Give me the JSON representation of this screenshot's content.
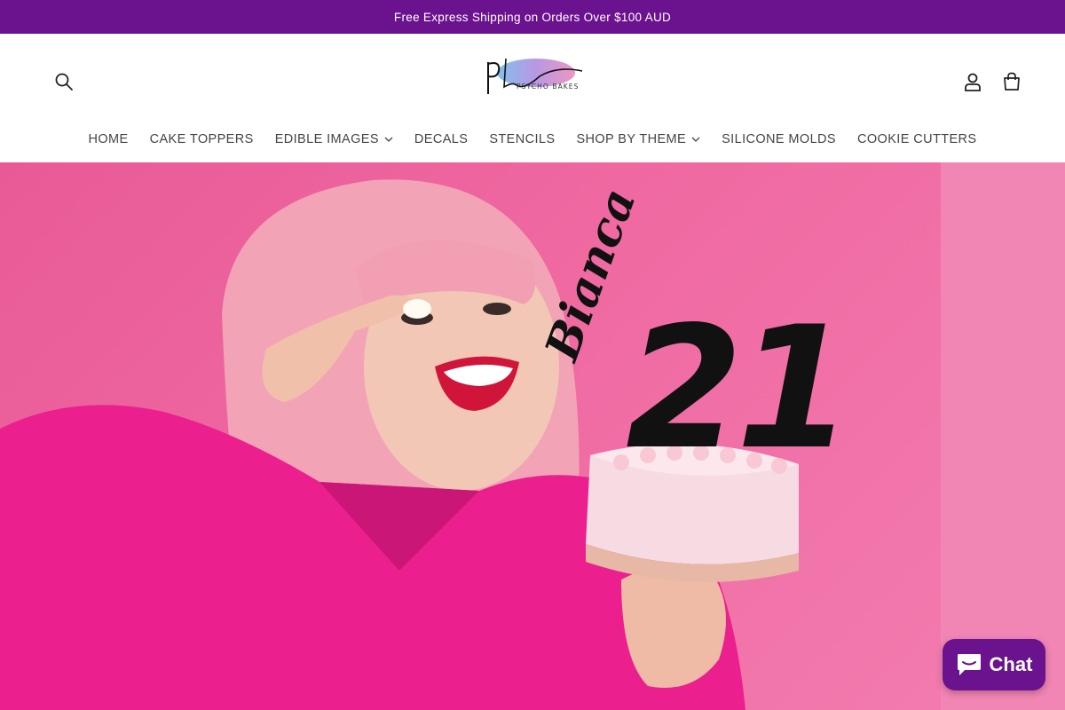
{
  "announcement": "Free Express Shipping on Orders Over $100 AUD",
  "logo": {
    "text": "PSYCHO BAKES"
  },
  "nav": [
    {
      "label": "HOME"
    },
    {
      "label": "CAKE TOPPERS"
    },
    {
      "label": "EDIBLE IMAGES"
    },
    {
      "label": "DECALS"
    },
    {
      "label": "STENCILS"
    },
    {
      "label": "SHOP BY THEME"
    },
    {
      "label": "SILICONE MOLDS"
    },
    {
      "label": "COOKIE CUTTERS"
    }
  ],
  "hero": {
    "topper_name": "Bianca",
    "topper_number": "21"
  },
  "chat": {
    "label": "Chat"
  },
  "colors": {
    "accent": "#6b128f",
    "hero_pink": "#ee5f9f",
    "shirt": "#ec1f8e"
  }
}
